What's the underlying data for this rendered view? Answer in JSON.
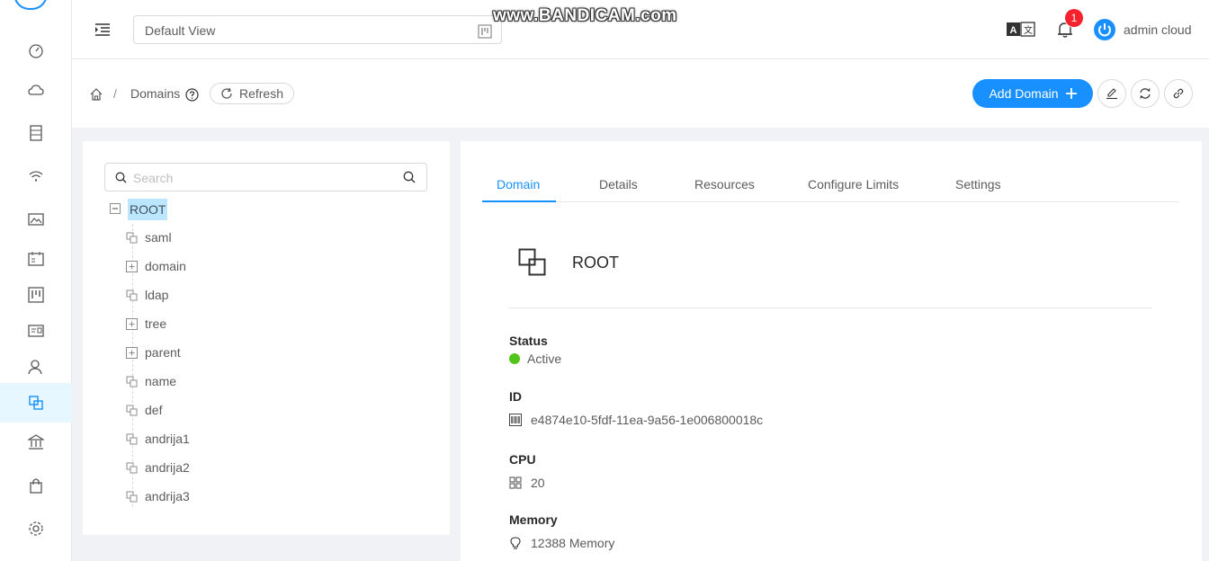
{
  "header": {
    "view_select_value": "Default View",
    "watermark": "www.BANDICAM.com",
    "notification_count": "1",
    "username": "admin cloud"
  },
  "breadcrumb": {
    "domains": "Domains",
    "separator": "/",
    "refresh_label": "Refresh"
  },
  "actions": {
    "add_domain_label": "Add Domain"
  },
  "tree": {
    "search_placeholder": "Search",
    "root": "ROOT",
    "children": [
      {
        "label": "saml",
        "type": "leaf"
      },
      {
        "label": "domain",
        "type": "expandable"
      },
      {
        "label": "ldap",
        "type": "leaf"
      },
      {
        "label": "tree",
        "type": "expandable"
      },
      {
        "label": "parent",
        "type": "expandable"
      },
      {
        "label": "name",
        "type": "leaf"
      },
      {
        "label": "def",
        "type": "leaf"
      },
      {
        "label": "andrija1",
        "type": "leaf"
      },
      {
        "label": "andrija2",
        "type": "leaf"
      },
      {
        "label": "andrija3",
        "type": "leaf"
      }
    ]
  },
  "tabs": [
    {
      "label": "Domain",
      "active": true
    },
    {
      "label": "Details",
      "active": false
    },
    {
      "label": "Resources",
      "active": false
    },
    {
      "label": "Configure Limits",
      "active": false
    },
    {
      "label": "Settings",
      "active": false
    }
  ],
  "detail": {
    "name": "ROOT",
    "status_label": "Status",
    "status_value": "Active",
    "id_label": "ID",
    "id_value": "e4874e10-5fdf-11ea-9a56-1e006800018c",
    "cpu_label": "CPU",
    "cpu_value": "20",
    "memory_label": "Memory",
    "memory_value": "12388 Memory"
  },
  "colors": {
    "primary": "#1890ff",
    "active_status": "#52c41a",
    "badge": "#f5222d",
    "selected_node_bg": "#bae7ff"
  }
}
